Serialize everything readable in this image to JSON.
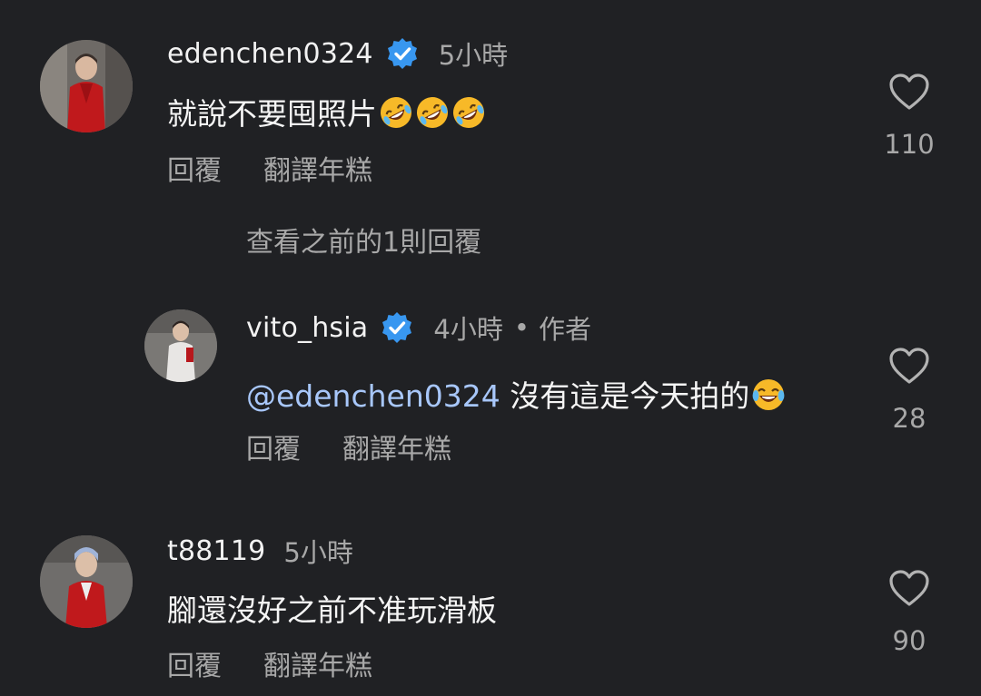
{
  "comments": [
    {
      "username": "edenchen0324",
      "verified": true,
      "time": "5小時",
      "text": "就說不要囤照片",
      "emojis": [
        "rolling-on-floor-laughing",
        "rolling-on-floor-laughing",
        "rolling-on-floor-laughing"
      ],
      "actions": {
        "reply": "回覆",
        "translate": "翻譯年糕"
      },
      "likes": "110"
    },
    {
      "username": "vito_hsia",
      "verified": true,
      "time": "4小時",
      "dot": "•",
      "author_badge": "作者",
      "mention": "@edenchen0324",
      "text": "沒有這是今天拍的",
      "emojis": [
        "face-with-tears-of-joy"
      ],
      "actions": {
        "reply": "回覆",
        "translate": "翻譯年糕"
      },
      "likes": "28"
    },
    {
      "username": "t88119",
      "verified": false,
      "time": "5小時",
      "text": "腳還沒好之前不准玩滑板",
      "actions": {
        "reply": "回覆",
        "translate": "翻譯年糕"
      },
      "likes": "90"
    }
  ],
  "view_previous_replies": "查看之前的1則回覆",
  "colors": {
    "background": "#202124",
    "primary_text": "#f5f5f5",
    "secondary_text": "#a8a8a8",
    "mention": "#a8c7fa",
    "verified": "#3897f0"
  }
}
